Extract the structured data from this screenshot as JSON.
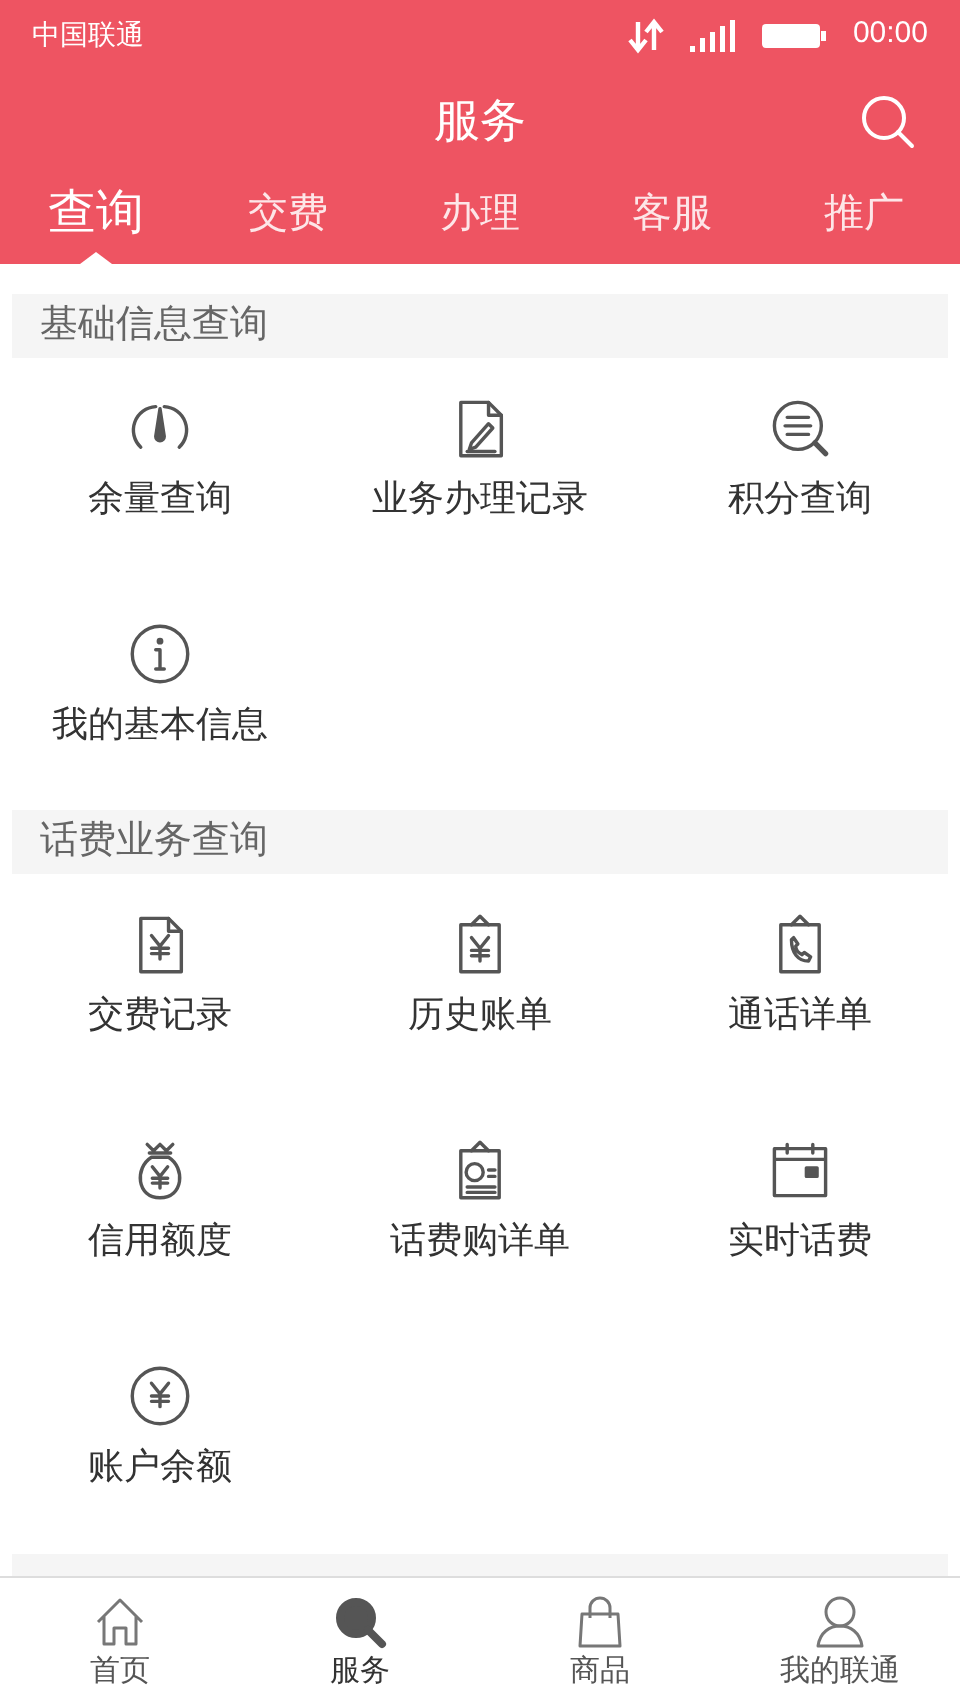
{
  "status_bar": {
    "carrier": "中国联通",
    "time": "00:00"
  },
  "header": {
    "title": "服务"
  },
  "tabs": [
    {
      "label": "查询",
      "selected": true
    },
    {
      "label": "交费",
      "selected": false
    },
    {
      "label": "办理",
      "selected": false
    },
    {
      "label": "客服",
      "selected": false
    },
    {
      "label": "推广",
      "selected": false
    }
  ],
  "sections": [
    {
      "title": "基础信息查询",
      "items": [
        {
          "label": "余量查询"
        },
        {
          "label": "业务办理记录"
        },
        {
          "label": "积分查询"
        },
        {
          "label": "我的基本信息"
        }
      ]
    },
    {
      "title": "话费业务查询",
      "items": [
        {
          "label": "交费记录"
        },
        {
          "label": "历史账单"
        },
        {
          "label": "通话详单"
        },
        {
          "label": "信用额度"
        },
        {
          "label": "话费购详单"
        },
        {
          "label": "实时话费"
        },
        {
          "label": "账户余额"
        }
      ]
    }
  ],
  "bottom_nav": [
    {
      "label": "首页",
      "selected": false
    },
    {
      "label": "服务",
      "selected": true
    },
    {
      "label": "商品",
      "selected": false
    },
    {
      "label": "我的联通",
      "selected": false
    }
  ]
}
